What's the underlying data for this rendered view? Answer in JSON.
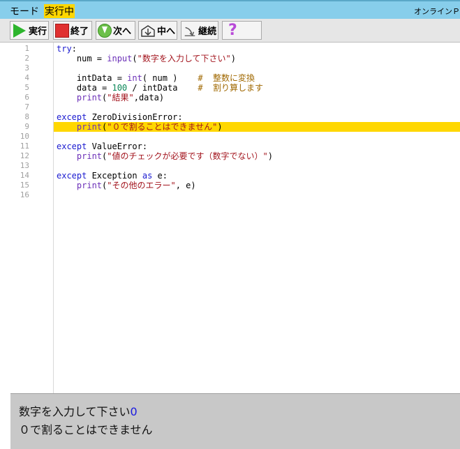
{
  "modebar": {
    "label": "モード",
    "status": "実行中",
    "app_name": "オンラインＰ"
  },
  "toolbar": {
    "buttons": [
      {
        "label": "実行",
        "icon": "play-icon"
      },
      {
        "label": "終了",
        "icon": "stop-icon"
      },
      {
        "label": "次へ",
        "icon": "down-arrow-icon"
      },
      {
        "label": "中へ",
        "icon": "step-into-icon"
      },
      {
        "label": "継続",
        "icon": "continue-icon"
      },
      {
        "label": "",
        "icon": "help-icon"
      }
    ],
    "help_glyph": "?"
  },
  "editor": {
    "current_line": 9,
    "lines": [
      {
        "no": "1",
        "tokens": [
          {
            "t": "try",
            "c": "kw"
          },
          {
            "t": ":",
            "c": "plain"
          }
        ]
      },
      {
        "no": "2",
        "tokens": [
          {
            "t": "    num = ",
            "c": "plain"
          },
          {
            "t": "input",
            "c": "fn"
          },
          {
            "t": "(",
            "c": "plain"
          },
          {
            "t": "\"数字を入力して下さい\"",
            "c": "str"
          },
          {
            "t": ")",
            "c": "plain"
          }
        ]
      },
      {
        "no": "3",
        "tokens": []
      },
      {
        "no": "4",
        "tokens": [
          {
            "t": "    intData = ",
            "c": "plain"
          },
          {
            "t": "int",
            "c": "fn"
          },
          {
            "t": "( num )    ",
            "c": "plain"
          },
          {
            "t": "#  整数に変換",
            "c": "cm"
          }
        ]
      },
      {
        "no": "5",
        "tokens": [
          {
            "t": "    data = ",
            "c": "plain"
          },
          {
            "t": "100",
            "c": "num"
          },
          {
            "t": " / intData    ",
            "c": "plain"
          },
          {
            "t": "#  割り算します",
            "c": "cm"
          }
        ]
      },
      {
        "no": "6",
        "tokens": [
          {
            "t": "    ",
            "c": "plain"
          },
          {
            "t": "print",
            "c": "fn"
          },
          {
            "t": "(",
            "c": "plain"
          },
          {
            "t": "\"結果\"",
            "c": "str"
          },
          {
            "t": ",data)",
            "c": "plain"
          }
        ]
      },
      {
        "no": "7",
        "tokens": []
      },
      {
        "no": "8",
        "tokens": [
          {
            "t": "except",
            "c": "kw"
          },
          {
            "t": " ZeroDivisionError:",
            "c": "plain"
          }
        ]
      },
      {
        "no": "9",
        "tokens": [
          {
            "t": "    ",
            "c": "plain"
          },
          {
            "t": "print",
            "c": "fn"
          },
          {
            "t": "(",
            "c": "plain"
          },
          {
            "t": "\"０で割ることはできません\"",
            "c": "str"
          },
          {
            "t": ")",
            "c": "plain"
          }
        ]
      },
      {
        "no": "10",
        "tokens": []
      },
      {
        "no": "11",
        "tokens": [
          {
            "t": "except",
            "c": "kw"
          },
          {
            "t": " ValueError:",
            "c": "plain"
          }
        ]
      },
      {
        "no": "12",
        "tokens": [
          {
            "t": "    ",
            "c": "plain"
          },
          {
            "t": "print",
            "c": "fn"
          },
          {
            "t": "(",
            "c": "plain"
          },
          {
            "t": "\"値のチェックが必要です（数字でない）\"",
            "c": "str"
          },
          {
            "t": ")",
            "c": "plain"
          }
        ]
      },
      {
        "no": "13",
        "tokens": []
      },
      {
        "no": "14",
        "tokens": [
          {
            "t": "except",
            "c": "kw"
          },
          {
            "t": " Exception ",
            "c": "plain"
          },
          {
            "t": "as",
            "c": "kw"
          },
          {
            "t": " e:",
            "c": "plain"
          }
        ]
      },
      {
        "no": "15",
        "tokens": [
          {
            "t": "    ",
            "c": "plain"
          },
          {
            "t": "print",
            "c": "fn"
          },
          {
            "t": "(",
            "c": "plain"
          },
          {
            "t": "\"その他のエラー\"",
            "c": "str"
          },
          {
            "t": ", e)",
            "c": "plain"
          }
        ]
      },
      {
        "no": "16",
        "tokens": []
      }
    ]
  },
  "console": {
    "prompt": "数字を入力して下さい",
    "input_value": "0",
    "output": "０で割ることはできません"
  },
  "colors": {
    "modebar_bg": "#87ceeb",
    "status_highlight": "#ffd700",
    "current_line_highlight": "#ffd700",
    "console_bg": "#c8c8c8"
  }
}
